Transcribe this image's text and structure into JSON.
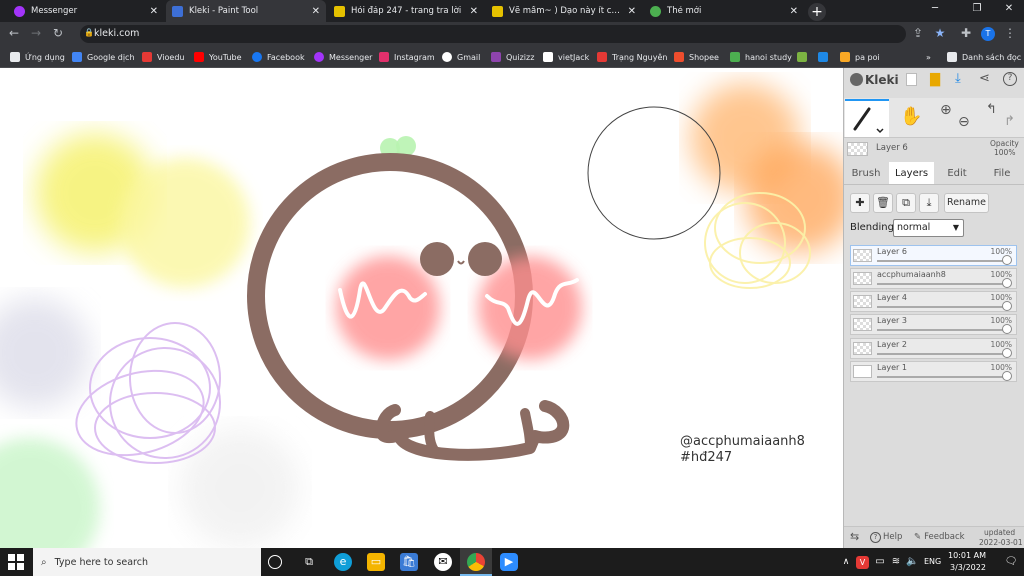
{
  "browser": {
    "tabs": [
      {
        "title": "Messenger",
        "icon": "messenger-icon",
        "color": "#a334fa"
      },
      {
        "title": "Kleki - Paint Tool",
        "icon": "kleki-icon",
        "color": "#3d6fd6"
      },
      {
        "title": "Hỏi đáp 247 - trang tra lời",
        "icon": "hoidap-icon",
        "color": "#e5c100"
      },
      {
        "title": "Vẽ mầm~ ) Dạo này ít cầu vẽ mầ",
        "icon": "hoidap-icon",
        "color": "#e5c100"
      },
      {
        "title": "Thẻ mới",
        "icon": "chrome-icon",
        "color": "#4caf50"
      }
    ],
    "url": "kleki.com",
    "bookmarks": [
      {
        "label": "Ứng dụng",
        "color": "#e8eaed"
      },
      {
        "label": "Google dịch",
        "color": "#4285f4"
      },
      {
        "label": "Vioedu",
        "color": "#e53935"
      },
      {
        "label": "YouTube",
        "color": "#ff0000"
      },
      {
        "label": "Facebook",
        "color": "#1877f2"
      },
      {
        "label": "Messenger",
        "color": "#a334fa"
      },
      {
        "label": "Instagram",
        "color": "#e1306c"
      },
      {
        "label": "Gmail",
        "color": "#ffffff"
      },
      {
        "label": "Quizizz",
        "color": "#8e44ad"
      },
      {
        "label": "vietJack",
        "color": "#ffffff"
      },
      {
        "label": "Trạng Nguyên",
        "color": "#e53935"
      },
      {
        "label": "Shopee",
        "color": "#ee4d2d"
      },
      {
        "label": "hanoi study",
        "color": "#4caf50"
      },
      {
        "label": "",
        "color": "#7cb342"
      },
      {
        "label": "",
        "color": "#1e88e5"
      },
      {
        "label": "pa poi",
        "color": "#f9a825"
      }
    ],
    "bookmarks_more": "»",
    "reading_list": "Danh sách đọc",
    "profile_initial": "T"
  },
  "canvas": {
    "watermark_line1": "@accphumaiaanh8",
    "watermark_line2": "#hđ247"
  },
  "kleki": {
    "logo": "Kleki",
    "current_layer": "Layer 6",
    "opacity_label": "Opacity",
    "opacity_value": "100%",
    "tabs": [
      "Brush",
      "Layers",
      "Edit",
      "File"
    ],
    "active_tab": "Layers",
    "rename_label": "Rename",
    "blending_label": "Blending",
    "blending_value": "normal",
    "layers": [
      {
        "name": "Layer 6",
        "opacity": "100%",
        "selected": true
      },
      {
        "name": "accphumaiaanh8",
        "opacity": "100%",
        "selected": false
      },
      {
        "name": "Layer 4",
        "opacity": "100%",
        "selected": false
      },
      {
        "name": "Layer 3",
        "opacity": "100%",
        "selected": false
      },
      {
        "name": "Layer 2",
        "opacity": "100%",
        "selected": false
      },
      {
        "name": "Layer 1",
        "opacity": "100%",
        "selected": false
      }
    ],
    "footer": {
      "help": "Help",
      "feedback": "Feedback",
      "updated_label": "updated",
      "updated_date": "2022-03-01"
    }
  },
  "taskbar": {
    "search_placeholder": "Type here to search",
    "language": "ENG",
    "time": "10:01 AM",
    "date": "3/3/2022"
  }
}
